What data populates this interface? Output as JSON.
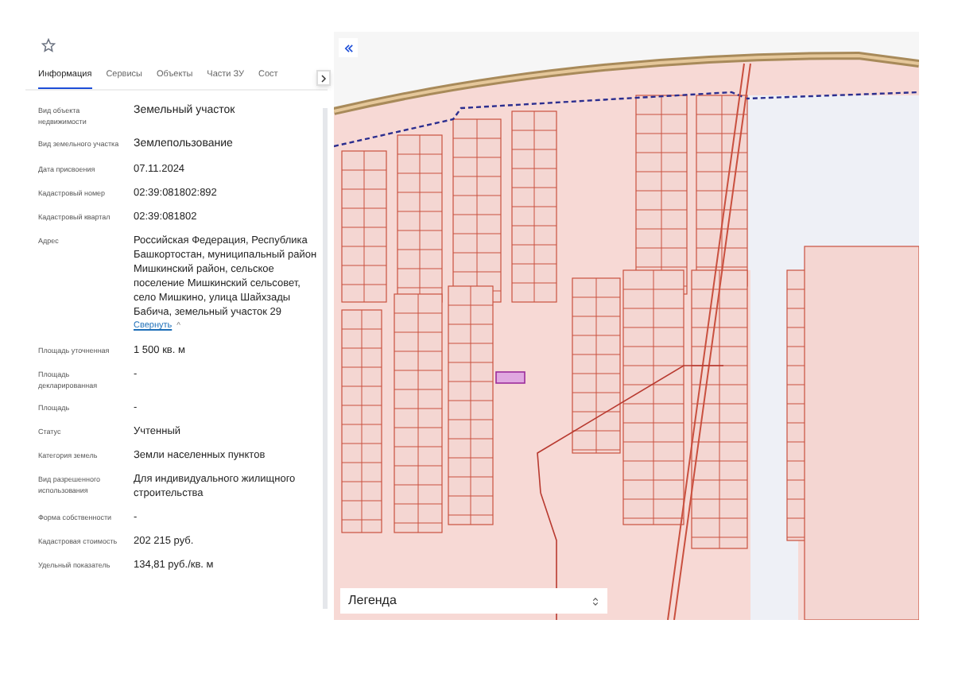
{
  "panel": {
    "tabs": [
      {
        "label": "Информация",
        "selected": true
      },
      {
        "label": "Сервисы",
        "selected": false
      },
      {
        "label": "Объекты",
        "selected": false
      },
      {
        "label": "Части ЗУ",
        "selected": false
      },
      {
        "label": "Сост",
        "selected": false
      }
    ],
    "rows": [
      {
        "label": "Вид объекта недвижимости",
        "value": "Земельный участок",
        "kind": "big"
      },
      {
        "label": "Вид земельного участка",
        "value": "Землепользование",
        "kind": "big"
      },
      {
        "label": "Дата присвоения",
        "value": "07.11.2024",
        "kind": "plain"
      },
      {
        "label": "Кадастровый номер",
        "value": "02:39:081802:892",
        "kind": "plain"
      },
      {
        "label": "Кадастровый квартал",
        "value": "02:39:081802",
        "kind": "plain"
      },
      {
        "label": "Адрес",
        "value": "Российская Федерация, Республика Башкортостан, муниципальный район Мишкинский район, сельское поселение Мишкинский сельсовет, село Мишкино, улица Шайхзады Бабича, земельный участок 29",
        "kind": "address",
        "link": "Свернуть",
        "link_icon": "^"
      },
      {
        "label": "Площадь уточненная",
        "value": "1 500 кв. м",
        "kind": "plain"
      },
      {
        "label": "Площадь декларированная",
        "value": "-",
        "kind": "plain"
      },
      {
        "label": "Площадь",
        "value": "-",
        "kind": "plain"
      },
      {
        "label": "Статус",
        "value": "Учтенный",
        "kind": "plain"
      },
      {
        "label": "Категория земель",
        "value": "Земли населенных пунктов",
        "kind": "plain"
      },
      {
        "label": "Вид разрешенного использования",
        "value": "Для индивидуального жилищного строительства",
        "kind": "plain"
      },
      {
        "label": "Форма собственности",
        "value": "-",
        "kind": "plain"
      },
      {
        "label": "Кадастровая стоимость",
        "value": "202 215 руб.",
        "kind": "plain"
      },
      {
        "label": "Удельный показатель",
        "value": "134,81 руб./кв. м",
        "kind": "plain"
      }
    ]
  },
  "map": {
    "legend": "Легенда"
  }
}
